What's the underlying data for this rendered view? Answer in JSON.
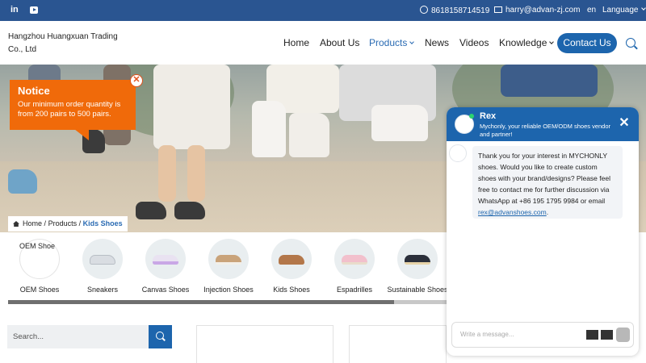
{
  "topbar": {
    "social": [
      "in",
      "youtube-icon"
    ],
    "phone": "8618158714519",
    "email": "harry@advan-zj.com",
    "lang_code": "en",
    "lang_label": "Language"
  },
  "header": {
    "brand": "Hangzhou Huangxuan Trading Co., Ltd",
    "nav": [
      "Home",
      "About Us",
      "Products",
      "News",
      "Videos",
      "Knowledge"
    ],
    "contact_label": "Contact Us"
  },
  "notice": {
    "title": "Notice",
    "text": "Our minimum order quantity is from 200 pairs to 500 pairs.",
    "close": "✕"
  },
  "breadcrumb": {
    "home": "Home",
    "sep": "/",
    "products": "Products",
    "current": "Kids Shoes"
  },
  "categories": [
    {
      "label": "OEM Shoes",
      "color": "#ffffff"
    },
    {
      "label": "Sneakers",
      "color": "#d9dde2"
    },
    {
      "label": "Canvas Shoes",
      "color": "#d6c8e8"
    },
    {
      "label": "Injection Shoes",
      "color": "#c9a37a"
    },
    {
      "label": "Kids Shoes",
      "color": "#b3774a"
    },
    {
      "label": "Espadrilles",
      "color": "#f2c0cc"
    },
    {
      "label": "Sustainable Shoes",
      "color": "#2b2f3a"
    }
  ],
  "oem_overlay": "OEM Shoe",
  "search": {
    "placeholder": "Search..."
  },
  "chat": {
    "name": "Rex",
    "subtitle": "Mychonly, your reliable OEM/ODM shoes vendor and partner!",
    "message": "Thank you for your interest in MYCHONLY shoes. Would you like to create custom shoes with your brand/designs? Please feel free to contact me for further discussion via WhatsApp at +86 195 1795 9984 or email",
    "email_link": "rex@advanshoes.com",
    "input_placeholder": "Write a message..."
  },
  "colors": {
    "brand_blue": "#1d65ad",
    "topbar": "#2a5591",
    "notice": "#f06a0a"
  }
}
